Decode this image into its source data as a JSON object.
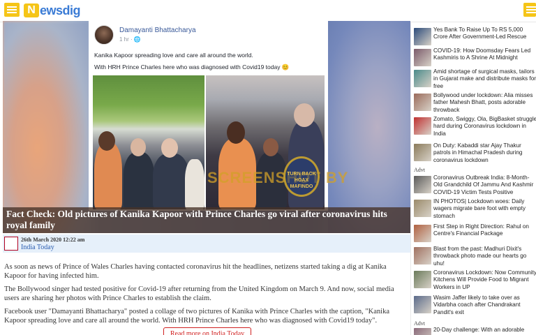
{
  "header": {
    "logo_badge": "N",
    "logo_text": "ewsdig"
  },
  "post": {
    "author": "Damayanti Bhattacharya",
    "meta": "1 hr · 🌐",
    "line1": "Kanika Kapoor spreading love and care all around the world.",
    "line2": "With HRH Prince Charles here who was diagnosed with Covid19 today 😊",
    "watermark": "SCREENSHOT BY",
    "seal_text": "TURN BACK HOAX MAFINDO"
  },
  "hero": {
    "caption": "Fact Check: Old pictures of Kanika Kapoor with Prince Charles go viral after coronavirus hits royal family"
  },
  "byline": {
    "date": "26th March 2020 12:22 am",
    "source": "India Today"
  },
  "article": {
    "p1": "As soon as news of Prince of Wales Charles having contacted coronavirus hit the headlines, netizens started taking a dig at Kanika Kapoor for having infected him.",
    "p2": "The Bollywood singer had tested positive for Covid-19 after returning from the United Kingdom on March 9. And now, social media users are sharing her photos with Prince Charles to establish the claim.",
    "p3": "Facebook user \"Damayanti Bhattacharya\" posted a collage of two pictures of Kanika with Prince Charles with the caption, \"Kanika Kapoor spreading love and care all around the world. With HRH Prince Charles here who was diagnosed with Covid19 today\".",
    "read_more": "Read more on India Today"
  },
  "sidebar": {
    "advt_label": "Advt",
    "items": [
      {
        "lines": [
          "Yes Bank To Raise Up To RS 5,000",
          "Crore After Government-Led Rescue"
        ],
        "color": "#2b4a7a"
      },
      {
        "lines": [
          "COVID-19: How Doomsday Fears Led",
          "Kashmiris to A Shrine At Midnight"
        ],
        "color": "#7a5a6a"
      },
      {
        "lines": [
          "Amid shortage of surgical masks, tailors",
          "in Gujarat make and distribute masks for",
          "free"
        ],
        "color": "#4a8a8a"
      },
      {
        "lines": [
          "Bollywood under lockdown: Alia misses",
          "father Mahesh Bhatt, posts adorable",
          "throwback"
        ],
        "color": "#9a6a5a"
      },
      {
        "lines": [
          "Zomato, Swiggy, Ola, BigBasket struggle",
          "hard during Coronavirus lockdown in",
          "India"
        ],
        "color": "#c03030"
      },
      {
        "lines": [
          "On Duty: Kabaddi star Ajay Thakur",
          "patrols in Himachal Pradesh during",
          "coronavirus lockdown"
        ],
        "color": "#8a7a5a"
      },
      {
        "lines": [
          "Coronavirus Outbreak India: 8-Month-",
          "Old Grandchild Of Jammu And Kashmir",
          "COVID-19 Victim Tests Positive"
        ],
        "color": "#5a5a5a"
      },
      {
        "lines": [
          "IN PHOTOS| Lockdown woes: Daily",
          "wagers migrate bare foot with empty",
          "stomach"
        ],
        "color": "#9a8a6a"
      },
      {
        "lines": [
          "First Step in Right Direction: Rahul on",
          "Centre's Financial Package"
        ],
        "color": "#b06040"
      },
      {
        "lines": [
          "Blast from the past: Madhuri Dixit's",
          "throwback photo made our hearts go",
          "uhu!"
        ],
        "color": "#a07060"
      },
      {
        "lines": [
          "Coronavirus Lockdown: Now Community",
          "Kitchens Will Provide Food to Migrant",
          "Workers in UP"
        ],
        "color": "#6a7a5a"
      },
      {
        "lines": [
          "Wasim Jaffer likely to take over as",
          "Vidarbha coach after Chandrakant",
          "Pandit's exit"
        ],
        "color": "#5a6a8a"
      },
      {
        "lines": [
          "20-Day challenge: With an adorable"
        ],
        "color": "#8a6a7a"
      }
    ]
  }
}
